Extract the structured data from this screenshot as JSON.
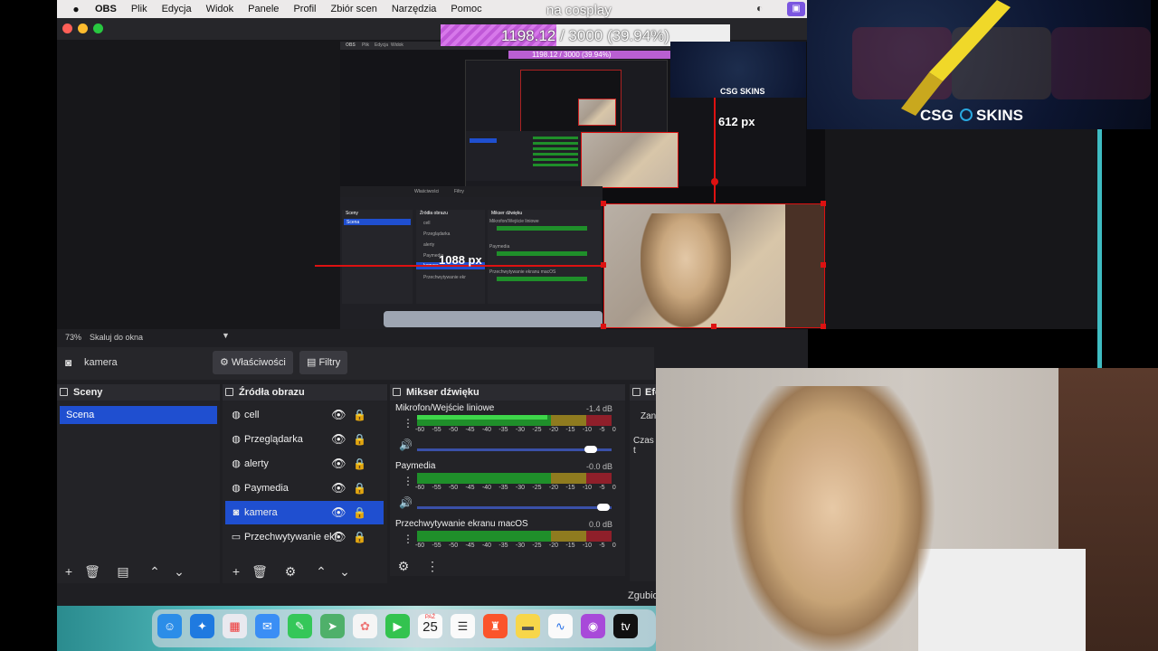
{
  "menubar": {
    "app_name": "OBS",
    "items": [
      "Plik",
      "Edycja",
      "Widok",
      "Panele",
      "Profil",
      "Zbiór scen",
      "Narzędzia",
      "Pomoc"
    ],
    "overlay_title": "na cosplay"
  },
  "progress": {
    "current": 1198.12,
    "goal": 3000,
    "fraction": 0.3994,
    "label_current": "1198.12",
    "label_rest": " / 3000 (39.94%)"
  },
  "nested_progress_label": "1198.12 / 3000 (39.94%)",
  "csg_banner": {
    "brand_left": "CSG",
    "brand_right": "SKINS",
    "small_brand": "CSG SKINS"
  },
  "measurements": {
    "vertical": "612 px",
    "horizontal": "1088 px"
  },
  "preview": {
    "zoom": "73%",
    "scale_mode": "Skaluj do okna"
  },
  "properties_bar": {
    "source_name": "kamera",
    "properties_label": "Właściwości",
    "filters_label": "Filtry"
  },
  "scenes": {
    "title": "Sceny",
    "items": [
      "Scena"
    ]
  },
  "sources": {
    "title": "Źródła obrazu",
    "items": [
      {
        "label": "cell",
        "icon": "globe"
      },
      {
        "label": "Przeglądarka",
        "icon": "globe"
      },
      {
        "label": "alerty",
        "icon": "globe"
      },
      {
        "label": "Paymedia",
        "icon": "globe"
      },
      {
        "label": "kamera",
        "icon": "camera",
        "selected": true
      },
      {
        "label": "Przechwytywanie ekr",
        "icon": "monitor"
      }
    ]
  },
  "mixer": {
    "title": "Mikser dźwięku",
    "channels": [
      {
        "name": "Mikrofon/Wejście liniowe",
        "db": "-1.4 dB",
        "level": 0.67
      },
      {
        "name": "Paymedia",
        "db": "-0.0 dB",
        "level": 0.0
      },
      {
        "name": "Przechwytywanie ekranu macOS",
        "db": "0.0 dB",
        "level": 0.0
      }
    ],
    "scale": [
      "-60",
      "-55",
      "-50",
      "-45",
      "-40",
      "-35",
      "-30",
      "-25",
      "-20",
      "-15",
      "-10",
      "-5",
      "0"
    ]
  },
  "effects_dock": {
    "title": "Efe",
    "row1": "Zan",
    "row2": "Czas t"
  },
  "status": {
    "text": "Zgubio"
  },
  "dock_calendar": {
    "month": "PAŹ",
    "day": "25"
  },
  "dock_apps": [
    "finder-icon",
    "safari-icon",
    "launchpad-icon",
    "mail-icon",
    "messages-icon",
    "maps-icon",
    "photos-icon",
    "facetime-icon",
    "calendar-icon",
    "reminders-icon",
    "brave-icon",
    "notes-icon",
    "freeform-icon",
    "podcasts-icon",
    "appletv-icon"
  ],
  "mini_preview": {
    "toolbar_a": "Właściwości",
    "toolbar_b": "Filtry",
    "scenes_title": "Sceny",
    "scene": "Scena",
    "sources_title": "Źródła obrazu",
    "source_items": [
      "cell",
      "Przeglądarka",
      "alerty",
      "Paymedia",
      "kamera",
      "Przechwytywanie ekr"
    ],
    "mixer_title": "Mikser dźwięku",
    "mixer_items": [
      "Mikrofon/Wejście liniowe",
      "Paymedia",
      "Przechwytywanie ekranu macOS"
    ],
    "obs_menu": [
      "OBS",
      "Plik",
      "Edycja",
      "Widok"
    ]
  },
  "colors": {
    "accent_blue": "#1f4fd0",
    "selection_red": "#d11111",
    "progress_pink": "#d778ea"
  }
}
